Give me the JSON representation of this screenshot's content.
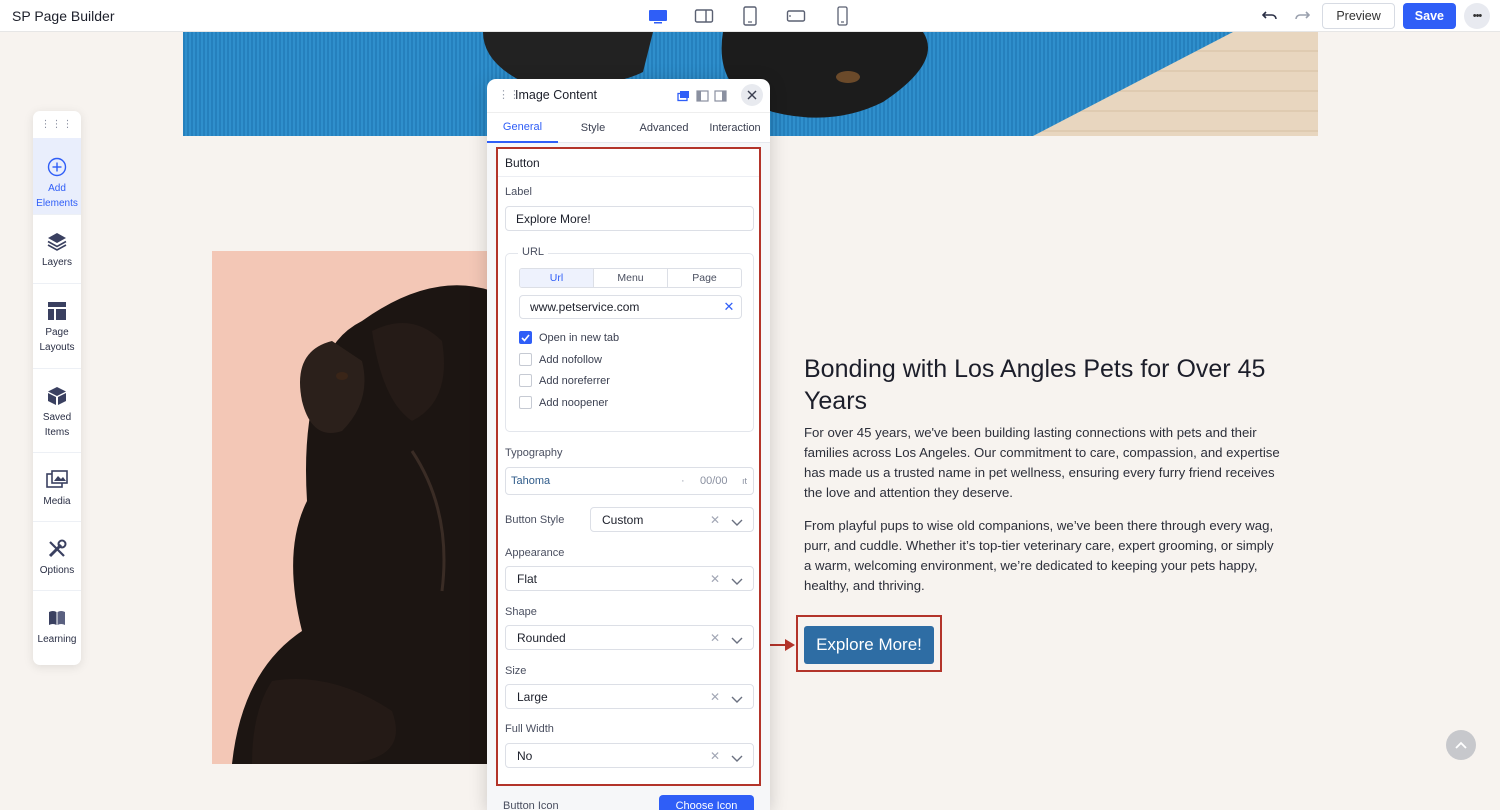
{
  "topbar": {
    "app_title": "SP Page Builder",
    "devices": [
      "desktop-icon",
      "laptop-icon",
      "tablet-icon",
      "tablet-landscape-icon",
      "mobile-icon"
    ],
    "preview_label": "Preview",
    "save_label": "Save",
    "more_label": "•••"
  },
  "sidebar": {
    "items": [
      {
        "label": "Add Elements",
        "icon": "plus-circle-icon"
      },
      {
        "label": "Layers",
        "icon": "layers-icon"
      },
      {
        "label": "Page Layouts",
        "icon": "layout-icon"
      },
      {
        "label": "Saved Items",
        "icon": "box-icon"
      },
      {
        "label": "Media",
        "icon": "media-icon"
      },
      {
        "label": "Options",
        "icon": "tools-icon"
      },
      {
        "label": "Learning",
        "icon": "book-icon"
      }
    ]
  },
  "content": {
    "heading": "Bonding with Los Angles Pets for Over 45 Years",
    "paragraph1": "For over 45 years, we've been building lasting connections with pets and their families across Los Angeles. Our commitment to care, compassion, and expertise has made us a trusted name in pet wellness, ensuring every furry friend receives the love and attention they deserve.",
    "paragraph2": "From playful pups to wise old companions, we’ve been there through every wag, purr, and cuddle. Whether it’s top-tier veterinary care, expert grooming, or simply a warm, welcoming environment, we’re dedicated to keeping your pets happy, healthy, and thriving.",
    "button_label": "Explore More!"
  },
  "panel": {
    "title": "Image Content",
    "tabs": [
      "General",
      "Style",
      "Advanced",
      "Interaction"
    ],
    "active_tab": "General",
    "section_title": "Button",
    "label_field": {
      "label": "Label",
      "value": "Explore More!"
    },
    "url": {
      "legend": "URL",
      "modes": [
        "Url",
        "Menu",
        "Page"
      ],
      "active_mode": "Url",
      "value": "www.petservice.com",
      "clear": "✕"
    },
    "checkboxes": [
      {
        "label": "Open in new tab",
        "checked": true
      },
      {
        "label": "Add nofollow",
        "checked": false
      },
      {
        "label": "Add noreferrer",
        "checked": false
      },
      {
        "label": "Add noopener",
        "checked": false
      }
    ],
    "typography": {
      "label": "Typography",
      "font": "Tahoma",
      "dot": "·",
      "size": "00/00",
      "toggle": "ıt"
    },
    "button_style": {
      "label": "Button Style",
      "value": "Custom"
    },
    "appearance": {
      "label": "Appearance",
      "value": "Flat"
    },
    "shape": {
      "label": "Shape",
      "value": "Rounded"
    },
    "size": {
      "label": "Size",
      "value": "Large"
    },
    "full_width": {
      "label": "Full Width",
      "value": "No"
    },
    "clear_glyph": "✕",
    "button_icon_label": "Button Icon",
    "choose_icon_label": "Choose Icon"
  },
  "colors": {
    "accent": "#2f5ef7",
    "highlight": "#b3342a",
    "cta": "#2e6da4"
  }
}
